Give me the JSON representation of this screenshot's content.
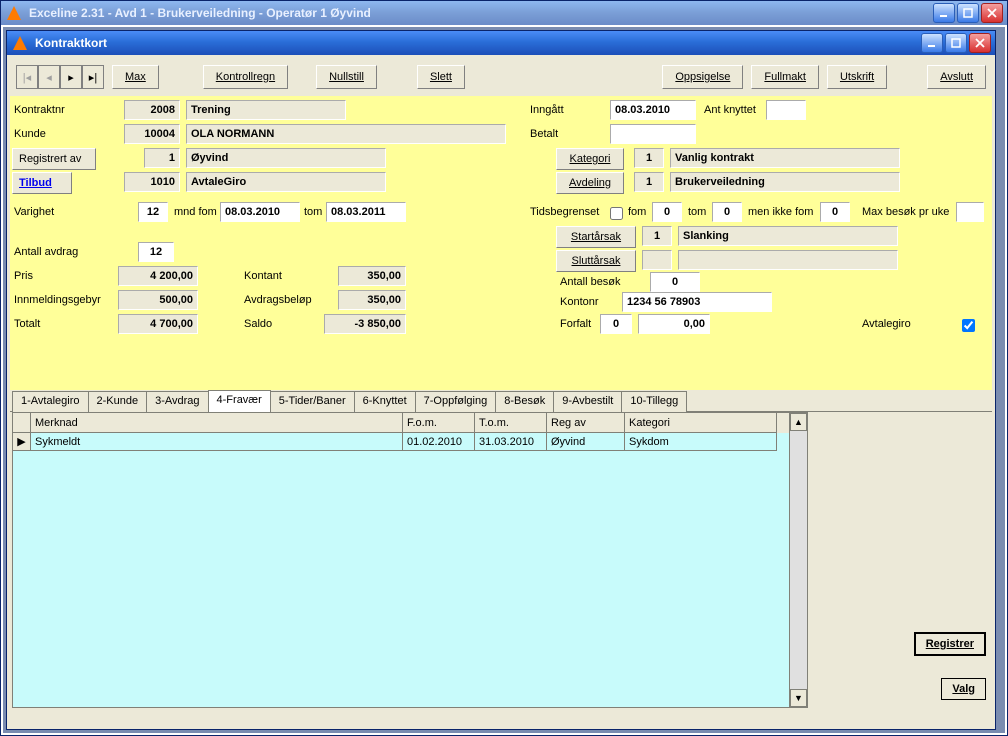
{
  "outer_window": {
    "title": "Exceline 2.31 - Avd 1 - Brukerveiledning - Operatør 1 Øyvind"
  },
  "inner_window": {
    "title": "Kontraktkort"
  },
  "toolbar": {
    "max": "Max",
    "kontrollregn": "Kontrollregn",
    "nullstill": "Nullstill",
    "slett": "Slett",
    "oppsigelse": "Oppsigelse",
    "fullmakt": "Fullmakt",
    "utskrift": "Utskrift",
    "avslutt": "Avslutt"
  },
  "labels": {
    "kontraktnr": "Kontraktnr",
    "kunde": "Kunde",
    "registrert_av": "Registrert av",
    "tilbud": "Tilbud",
    "varighet": "Varighet",
    "mnd_fom": "mnd fom",
    "tom": "tom",
    "antall_avdrag": "Antall avdrag",
    "pris": "Pris",
    "innmeldingsgebyr": "Innmeldingsgebyr",
    "totalt": "Totalt",
    "kontant": "Kontant",
    "avdragsbelop": "Avdragsbeløp",
    "saldo": "Saldo",
    "inngatt": "Inngått",
    "betalt": "Betalt",
    "kategori": "Kategori",
    "avdeling": "Avdeling",
    "tidsbegrenset": "Tidsbegrenset",
    "fom": "fom",
    "tom2": "tom",
    "men_ikke_fom": "men ikke fom",
    "max_besok": "Max besøk pr uke",
    "startarsak": "Startårsak",
    "sluttarsak": "Sluttårsak",
    "antall_besok": "Antall besøk",
    "kontonr": "Kontonr",
    "forfalt": "Forfalt",
    "avtalegiro": "Avtalegiro",
    "ant_knyttet": "Ant knyttet"
  },
  "values": {
    "kontraktnr": "2008",
    "kontrakt_type": "Trening",
    "kunde_nr": "10004",
    "kunde_navn": "OLA NORMANN",
    "reg_av_nr": "1",
    "reg_av_navn": "Øyvind",
    "tilbud_nr": "1010",
    "tilbud_navn": "AvtaleGiro",
    "varighet": "12",
    "fom_dato": "08.03.2010",
    "tom_dato": "08.03.2011",
    "antall_avdrag": "12",
    "pris": "4 200,00",
    "innmeldingsgebyr": "500,00",
    "totalt": "4 700,00",
    "kontant": "350,00",
    "avdragsbelop": "350,00",
    "saldo": "-3 850,00",
    "inngatt": "08.03.2010",
    "betalt": "",
    "kategori_nr": "1",
    "kategori_navn": "Vanlig kontrakt",
    "avdeling_nr": "1",
    "avdeling_navn": "Brukerveiledning",
    "tb_fom": "0",
    "tb_tom": "0",
    "tb_ikke": "0",
    "max_besok": "",
    "startarsak_nr": "1",
    "startarsak_navn": "Slanking",
    "sluttarsak_nr": "",
    "sluttarsak_navn": "",
    "antall_besok": "0",
    "kontonr": "1234 56 78903",
    "forfalt_n": "0",
    "forfalt_b": "0,00",
    "ant_knyttet": ""
  },
  "tabs": [
    "1-Avtalegiro",
    "2-Kunde",
    "3-Avdrag",
    "4-Fravær",
    "5-Tider/Baner",
    "6-Knyttet",
    "7-Oppfølging",
    "8-Besøk",
    "9-Avbestilt",
    "10-Tillegg"
  ],
  "active_tab": 3,
  "grid": {
    "headers": [
      "Merknad",
      "F.o.m.",
      "T.o.m.",
      "Reg av",
      "Kategori"
    ],
    "widths": [
      372,
      72,
      72,
      78,
      152
    ],
    "rows": [
      {
        "merknad": "Sykmeldt",
        "fom": "01.02.2010",
        "tom": "31.03.2010",
        "regav": "Øyvind",
        "kategori": "Sykdom"
      }
    ]
  },
  "side_buttons": {
    "registrer": "Registrer",
    "valg": "Valg"
  }
}
